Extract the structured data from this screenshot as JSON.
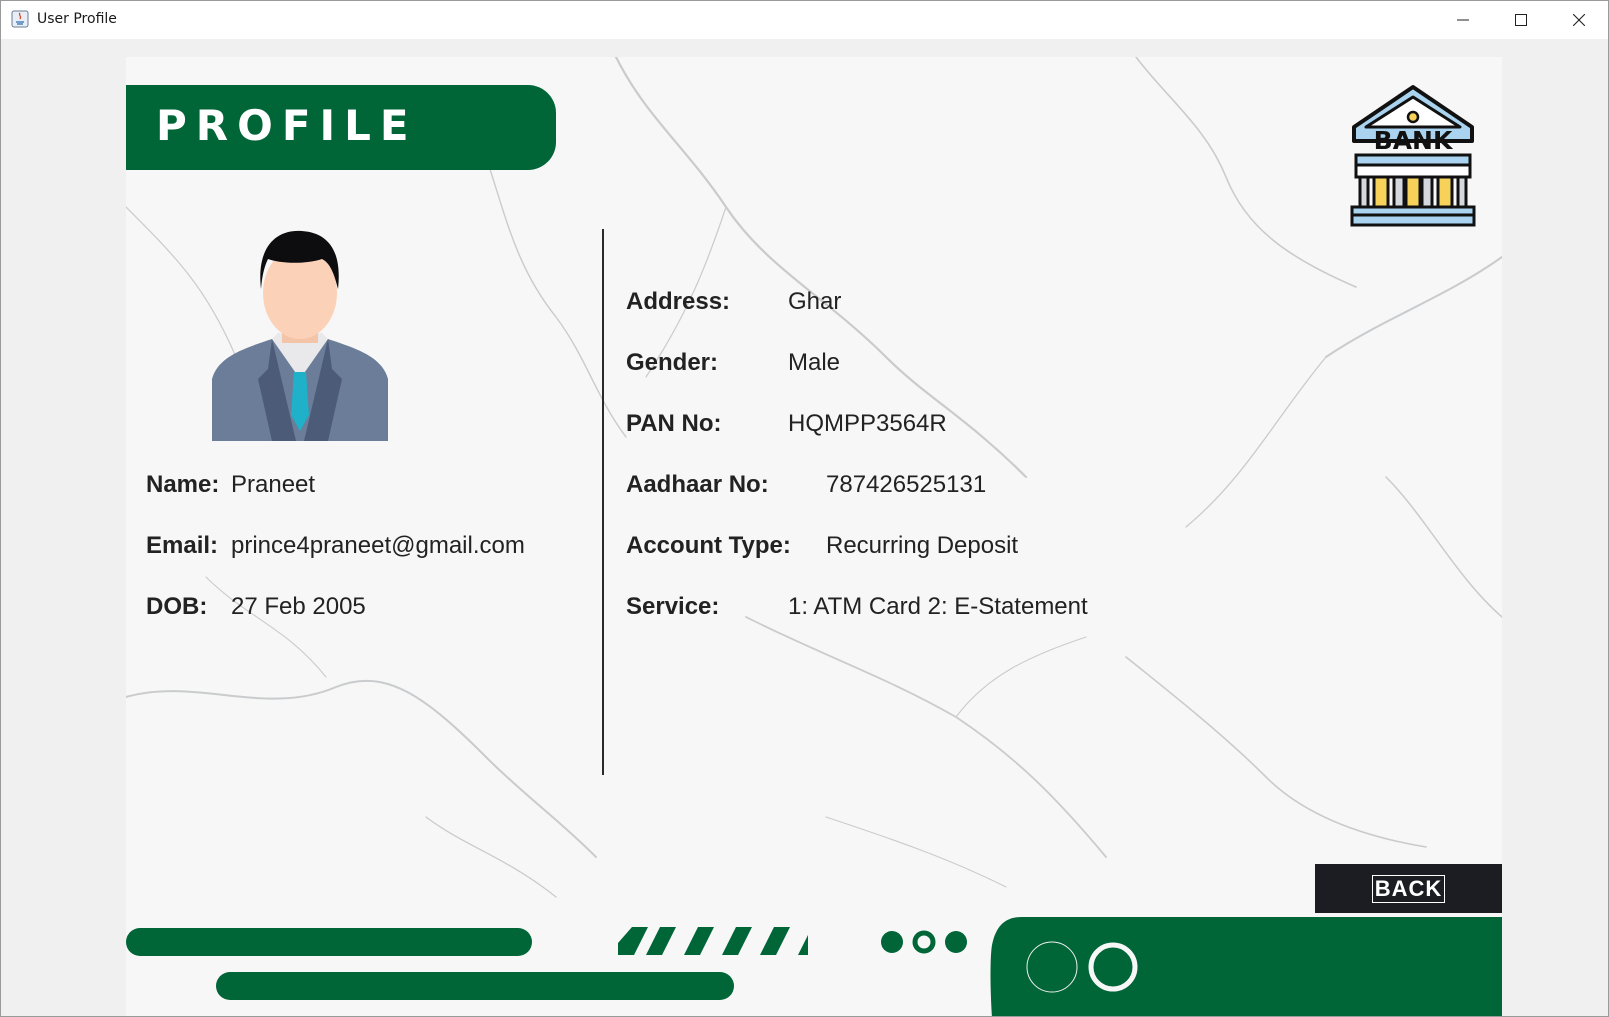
{
  "window": {
    "title": "User Profile",
    "minimize_icon": "minimize-icon",
    "maximize_icon": "maximize-icon",
    "close_icon": "close-icon"
  },
  "header": {
    "title": "PROFILE",
    "logo_text": "BANK"
  },
  "left_details": [
    {
      "label": "Name:",
      "value": "Praneet"
    },
    {
      "label": "Email:",
      "value": "prince4praneet@gmail.com"
    },
    {
      "label": "DOB:",
      "value": "27 Feb 2005"
    }
  ],
  "right_details": [
    {
      "label": "Address:",
      "value": "Ghar"
    },
    {
      "label": "Gender:",
      "value": "Male"
    },
    {
      "label": "PAN No:",
      "value": "HQMPP3564R"
    },
    {
      "label": "Aadhaar No:",
      "value": "787426525131"
    },
    {
      "label": "Account Type:",
      "value": "Recurring Deposit"
    },
    {
      "label": "Service:",
      "value": "1: ATM Card 2: E-Statement"
    }
  ],
  "actions": {
    "back_label": "BACK"
  },
  "colors": {
    "brand_green": "#006537",
    "back_button": "#1b1d22"
  }
}
